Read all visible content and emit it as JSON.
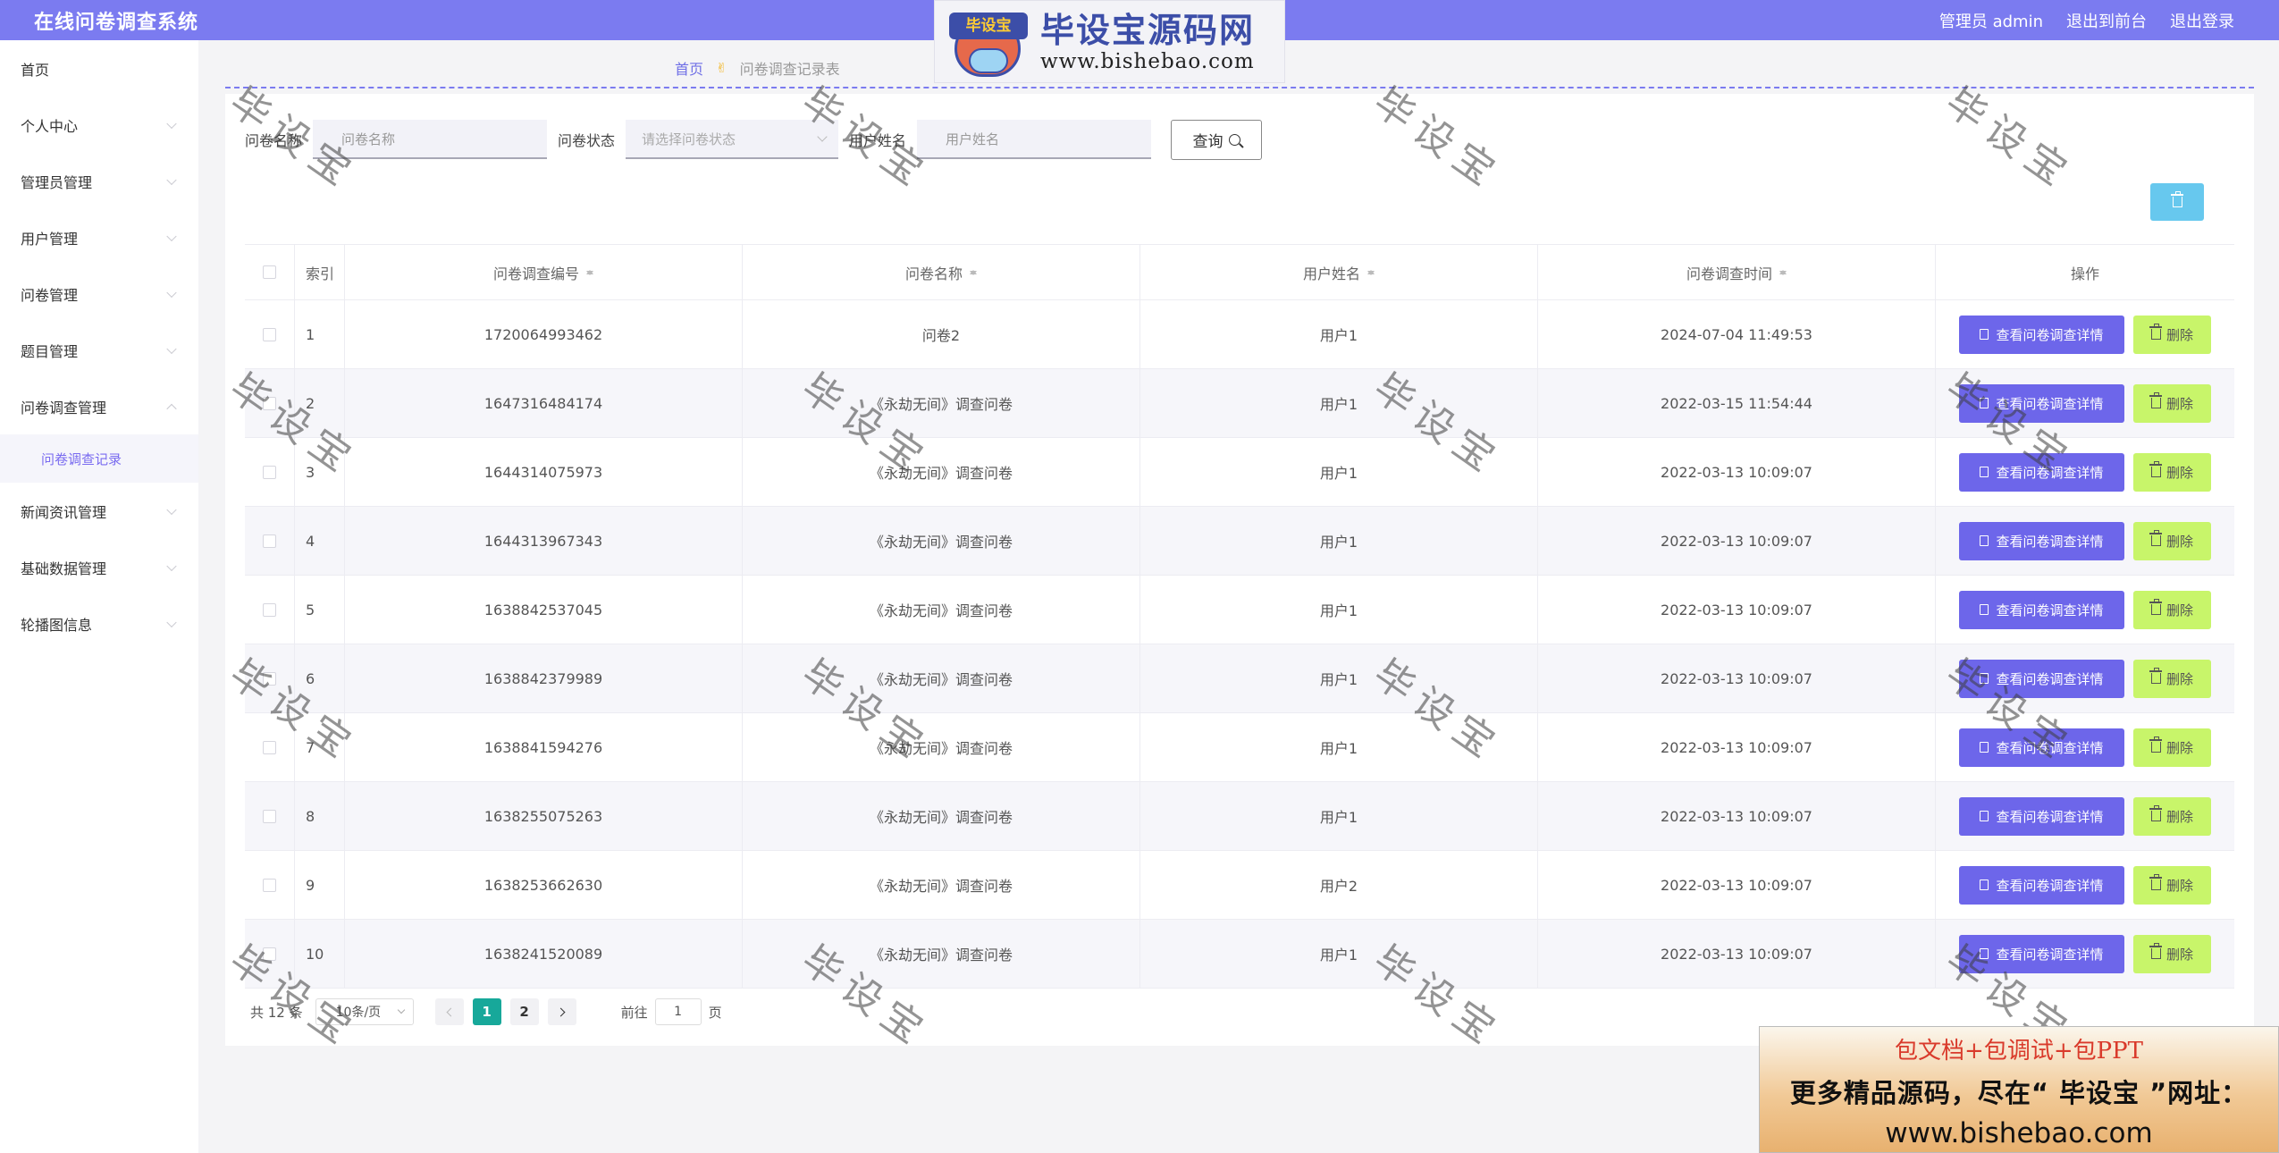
{
  "app": {
    "title": "在线问卷调查系统"
  },
  "header": {
    "admin_label": "管理员 admin",
    "front_label": "退出到前台",
    "logout_label": "退出登录"
  },
  "brand": {
    "badge": "毕设宝",
    "name": "毕设宝源码网",
    "url": "www.bishebao.com"
  },
  "sidebar": {
    "items": [
      {
        "label": "首页",
        "has_chevron": false
      },
      {
        "label": "个人中心",
        "has_chevron": true
      },
      {
        "label": "管理员管理",
        "has_chevron": true
      },
      {
        "label": "用户管理",
        "has_chevron": true
      },
      {
        "label": "问卷管理",
        "has_chevron": true
      },
      {
        "label": "题目管理",
        "has_chevron": true
      },
      {
        "label": "问卷调查管理",
        "has_chevron": true,
        "expanded": true
      },
      {
        "label": "新闻资讯管理",
        "has_chevron": true
      },
      {
        "label": "基础数据管理",
        "has_chevron": true
      },
      {
        "label": "轮播图信息",
        "has_chevron": true
      }
    ],
    "subitem": {
      "label": "问卷调查记录"
    }
  },
  "breadcrumb": {
    "home": "首页",
    "sep": "✌",
    "current": "问卷调查记录表"
  },
  "search": {
    "name_label": "问卷名称",
    "name_placeholder": "问卷名称",
    "status_label": "问卷状态",
    "status_placeholder": "请选择问卷状态",
    "user_label": "用户姓名",
    "user_placeholder": "用户姓名",
    "query_label": "查询"
  },
  "table": {
    "headers": {
      "index": "索引",
      "number": "问卷调查编号",
      "name": "问卷名称",
      "user": "用户姓名",
      "time": "问卷调查时间",
      "ops": "操作"
    },
    "view_label": "查看问卷调查详情",
    "delete_label": "删除",
    "rows": [
      {
        "index": "1",
        "number": "1720064993462",
        "name": "问卷2",
        "user": "用户1",
        "time": "2024-07-04 11:49:53"
      },
      {
        "index": "2",
        "number": "1647316484174",
        "name": "《永劫无间》调查问卷",
        "user": "用户1",
        "time": "2022-03-15 11:54:44"
      },
      {
        "index": "3",
        "number": "1644314075973",
        "name": "《永劫无间》调查问卷",
        "user": "用户1",
        "time": "2022-03-13 10:09:07"
      },
      {
        "index": "4",
        "number": "1644313967343",
        "name": "《永劫无间》调查问卷",
        "user": "用户1",
        "time": "2022-03-13 10:09:07"
      },
      {
        "index": "5",
        "number": "1638842537045",
        "name": "《永劫无间》调查问卷",
        "user": "用户1",
        "time": "2022-03-13 10:09:07"
      },
      {
        "index": "6",
        "number": "1638842379989",
        "name": "《永劫无间》调查问卷",
        "user": "用户1",
        "time": "2022-03-13 10:09:07"
      },
      {
        "index": "7",
        "number": "1638841594276",
        "name": "《永劫无间》调查问卷",
        "user": "用户1",
        "time": "2022-03-13 10:09:07"
      },
      {
        "index": "8",
        "number": "1638255075263",
        "name": "《永劫无间》调查问卷",
        "user": "用户1",
        "time": "2022-03-13 10:09:07"
      },
      {
        "index": "9",
        "number": "1638253662630",
        "name": "《永劫无间》调查问卷",
        "user": "用户2",
        "time": "2022-03-13 10:09:07"
      },
      {
        "index": "10",
        "number": "1638241520089",
        "name": "《永劫无间》调查问卷",
        "user": "用户1",
        "time": "2022-03-13 10:09:07"
      }
    ]
  },
  "pagination": {
    "total_text": "共 12 条",
    "page_size": "10条/页",
    "pages": [
      "1",
      "2"
    ],
    "current_page": "1",
    "goto_prefix": "前往",
    "goto_value": "1",
    "goto_suffix": "页"
  },
  "watermark": {
    "text": "毕设宝"
  },
  "ad": {
    "line1": "包文档+包调试+包PPT",
    "line2": "更多精品源码，尽在“ 毕设宝 ”网址：",
    "line3": "www.bishebao.com"
  },
  "colors": {
    "primary": "#7b7bf0",
    "view_button": "#6d66ea",
    "delete_button": "#c8f56a",
    "page_active": "#17a89a",
    "bulk_delete": "#67c8ee"
  }
}
